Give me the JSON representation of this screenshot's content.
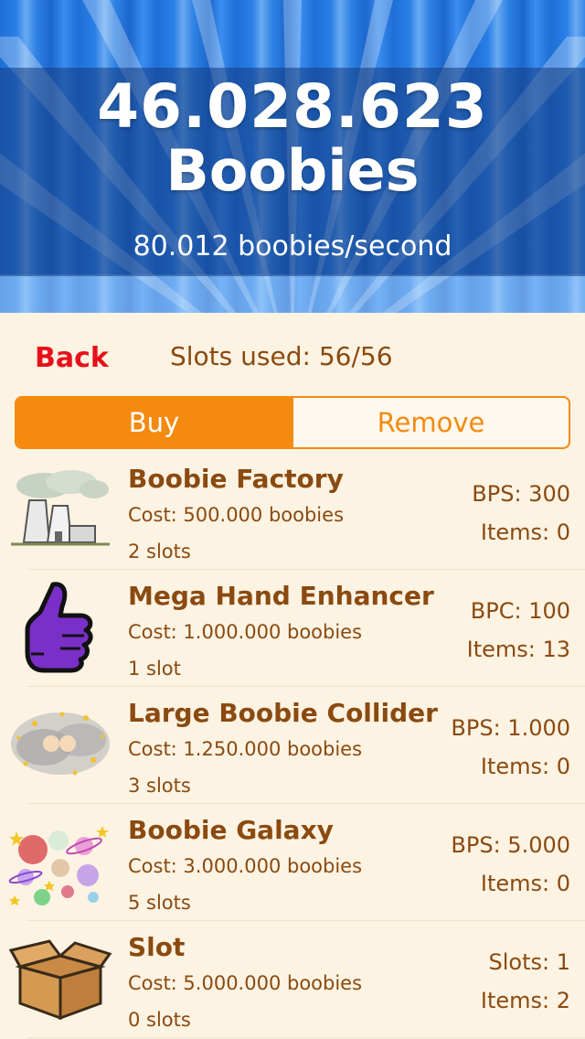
{
  "header": {
    "score": "46.028.623",
    "score_unit": "Boobies",
    "rate": "80.012 boobies/second"
  },
  "toolbar": {
    "back_label": "Back",
    "slots_used": "Slots used: 56/56"
  },
  "segments": {
    "buy_label": "Buy",
    "remove_label": "Remove",
    "selected": "Buy"
  },
  "items": [
    {
      "name": "Boobie Factory",
      "cost": "Cost: 500.000 boobies",
      "slots": "2 slots",
      "stat": "BPS: 300",
      "count": "Items: 0",
      "icon": "factory-icon"
    },
    {
      "name": "Mega Hand Enhancer",
      "cost": "Cost: 1.000.000 boobies",
      "slots": "1 slot",
      "stat": "BPC: 100",
      "count": "Items: 13",
      "icon": "thumbs-up-hand-icon"
    },
    {
      "name": "Large Boobie Collider",
      "cost": "Cost: 1.250.000 boobies",
      "slots": "3 slots",
      "stat": "BPS: 1.000",
      "count": "Items: 0",
      "icon": "collider-icon"
    },
    {
      "name": "Boobie Galaxy",
      "cost": "Cost: 3.000.000 boobies",
      "slots": "5 slots",
      "stat": "BPS: 5.000",
      "count": "Items: 0",
      "icon": "galaxy-icon"
    },
    {
      "name": "Slot",
      "cost": "Cost: 5.000.000 boobies",
      "slots": "0 slots",
      "stat": "Slots: 1",
      "count": "Items: 2",
      "icon": "cardboard-box-icon"
    }
  ],
  "colors": {
    "accent": "#f58a10",
    "back": "#e8101a",
    "text": "#8a4a10",
    "background": "#fdf3e3",
    "header_blue": "#2a7fe6"
  }
}
